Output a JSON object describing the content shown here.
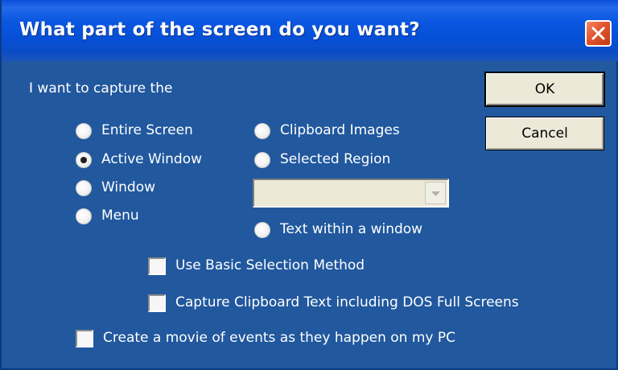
{
  "window": {
    "title": "What part of the screen do you want?",
    "close_icon": "close-icon"
  },
  "prompt_label": "I want to capture the",
  "capture_options": [
    {
      "label": "Entire Screen",
      "selected": false
    },
    {
      "label": "Active Window",
      "selected": true
    },
    {
      "label": "Window",
      "selected": false
    },
    {
      "label": "Menu",
      "selected": false
    },
    {
      "label": "Clipboard Images",
      "selected": false
    },
    {
      "label": "Selected Region",
      "selected": false
    },
    {
      "label": "Text within a window",
      "selected": false
    }
  ],
  "region_dropdown": {
    "value": "",
    "enabled": false,
    "arrow_icon": "chevron-down-icon"
  },
  "checkboxes": [
    {
      "label": "Use Basic Selection Method",
      "checked": false
    },
    {
      "label": "Capture Clipboard Text including DOS Full Screens",
      "checked": false
    },
    {
      "label": "Create a movie of events as they happen on my PC",
      "checked": false
    }
  ],
  "buttons": {
    "ok_label": "OK",
    "cancel_label": "Cancel"
  },
  "colors": {
    "dialog_background": "#21589e",
    "titlebar_blue": "#0a57e0",
    "close_red": "#e2542d",
    "button_face": "#ece9d8"
  }
}
